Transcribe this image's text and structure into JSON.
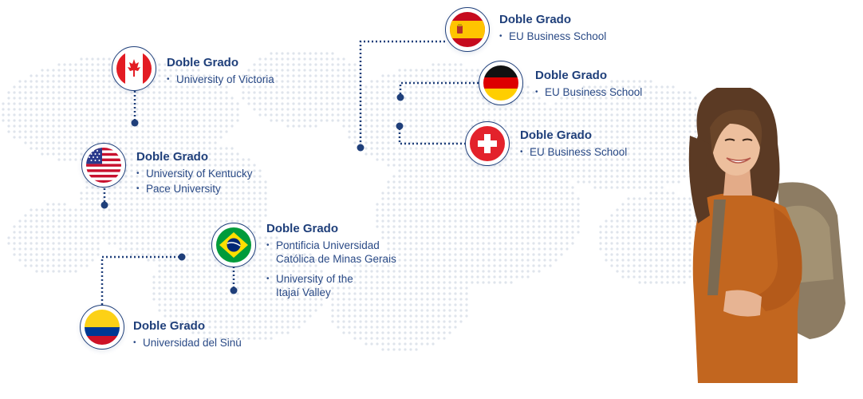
{
  "programs": [
    {
      "id": "spain",
      "flag_icon": "spain-flag-icon",
      "heading": "Doble Grado",
      "universities": [
        "EU Business School"
      ]
    },
    {
      "id": "canada",
      "flag_icon": "canada-flag-icon",
      "heading": "Doble Grado",
      "universities": [
        "University of Victoria"
      ]
    },
    {
      "id": "germany",
      "flag_icon": "germany-flag-icon",
      "heading": "Doble Grado",
      "universities": [
        "EU Business School"
      ]
    },
    {
      "id": "switzerland",
      "flag_icon": "switzerland-flag-icon",
      "heading": "Doble Grado",
      "universities": [
        "EU Business School"
      ]
    },
    {
      "id": "usa",
      "flag_icon": "usa-flag-icon",
      "heading": "Doble Grado",
      "universities": [
        "University of Kentucky",
        "Pace University"
      ]
    },
    {
      "id": "brazil",
      "flag_icon": "brazil-flag-icon",
      "heading": "Doble Grado",
      "universities": [
        "Pontificia Universidad Católica de Minas Gerais",
        "University of the Itajaí Valley"
      ]
    },
    {
      "id": "colombia",
      "flag_icon": "colombia-flag-icon",
      "heading": "Doble Grado",
      "universities": [
        "Universidad del Sinú"
      ]
    }
  ],
  "colors": {
    "accent": "#1f3f7a",
    "map_dots": "#dfe4ec"
  }
}
